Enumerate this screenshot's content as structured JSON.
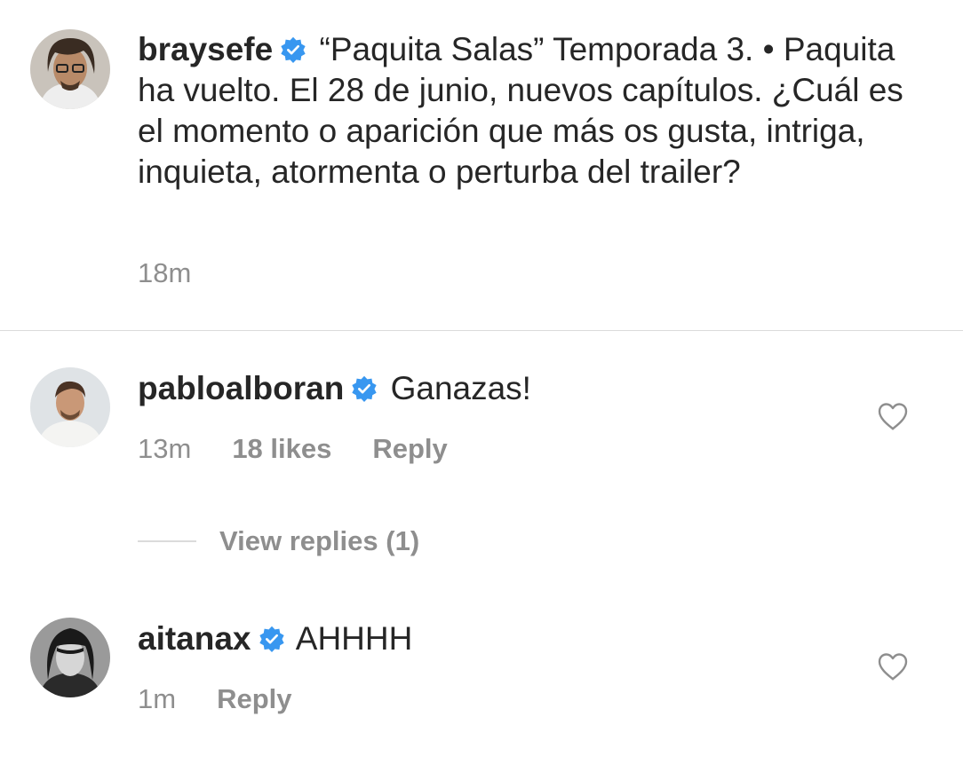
{
  "post": {
    "username": "braysefe",
    "caption": "“Paquita Salas” Temporada 3. • Paquita ha vuelto. El 28 de junio, nuevos capítulos. ¿Cuál es el momento o aparición que más os gusta, intriga, inquieta, atormenta o perturba del trailer?",
    "time": "18m",
    "avatar_icon": "profile-photo"
  },
  "comments": [
    {
      "username": "pabloalboran",
      "text": "Ganazas!",
      "time": "13m",
      "likes": "18 likes",
      "reply_label": "Reply",
      "view_replies": "View replies (1)",
      "like_icon": "heart-outline-icon"
    },
    {
      "username": "aitanax",
      "text": "AHHHH",
      "time": "1m",
      "reply_label": "Reply",
      "like_icon": "heart-outline-icon"
    }
  ],
  "colors": {
    "verified_blue": "#3897f0",
    "secondary_text": "#8e8e8e",
    "primary_text": "#262626",
    "divider": "#dbdbdb"
  }
}
